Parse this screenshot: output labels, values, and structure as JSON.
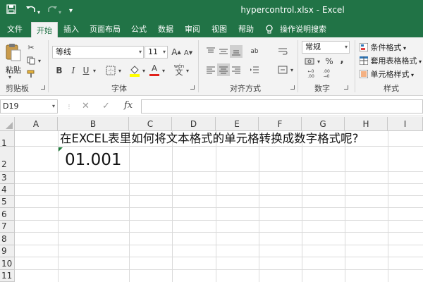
{
  "titlebar": {
    "save_icon": "save-icon",
    "undo_icon": "undo-icon",
    "redo_icon": "redo-icon",
    "customize_icon": "customize-qat-icon",
    "title": "hypercontrol.xlsx  -  Excel"
  },
  "tabs": [
    "文件",
    "开始",
    "插入",
    "页面布局",
    "公式",
    "数据",
    "审阅",
    "视图",
    "帮助"
  ],
  "active_tab": "开始",
  "tell_me": "操作说明搜索",
  "ribbon": {
    "clipboard": {
      "paste_label": "粘贴",
      "group_label": "剪贴板"
    },
    "font": {
      "font_name": "等线",
      "font_size": "11",
      "bold": "B",
      "italic": "I",
      "underline": "U",
      "font_color_glyph": "A",
      "phonetic_glyph": "wén",
      "grow": "A",
      "shrink": "A",
      "group_label": "字体"
    },
    "alignment": {
      "group_label": "对齐方式",
      "wrap_glyph": "ab"
    },
    "number": {
      "format": "常规",
      "percent": "%",
      "comma": ",",
      "group_label": "数字"
    },
    "styles": {
      "conditional": "条件格式",
      "table": "套用表格格式",
      "cell_styles": "单元格样式",
      "group_label": "样式"
    }
  },
  "formula_bar": {
    "name_box": "D19",
    "cancel": "✕",
    "enter": "✓",
    "fx": "fx",
    "formula": ""
  },
  "columns": [
    "A",
    "B",
    "C",
    "D",
    "E",
    "F",
    "G",
    "H",
    "I"
  ],
  "rows": [
    "1",
    "2",
    "3",
    "4",
    "5",
    "6",
    "7",
    "8",
    "9",
    "10",
    "11"
  ],
  "cells": {
    "B1": "在EXCEL表里如何将文本格式的单元格转换成数字格式呢?",
    "B2": "01.001"
  },
  "colors": {
    "brand": "#217346",
    "ribbon_bg": "#f3f3f3",
    "header_bg": "#efefef"
  }
}
